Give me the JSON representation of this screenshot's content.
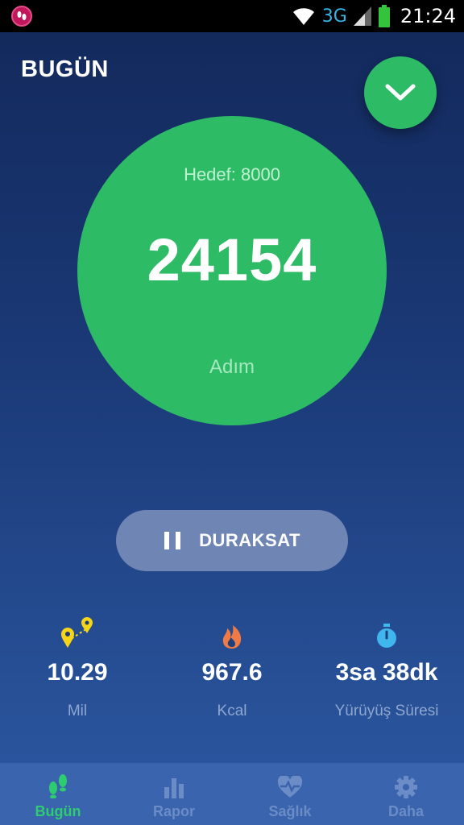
{
  "status_bar": {
    "network": "3G",
    "time": "21:24"
  },
  "header": {
    "title": "BUGÜN"
  },
  "steps": {
    "goal": "Hedef: 8000",
    "count": "24154",
    "unit": "Adım"
  },
  "pause_button": {
    "label": "DURAKSAT"
  },
  "stats": [
    {
      "icon": "map-pins-icon",
      "value": "10.29",
      "label": "Mil"
    },
    {
      "icon": "flame-icon",
      "value": "967.6",
      "label": "Kcal"
    },
    {
      "icon": "stopwatch-icon",
      "value": "3sa 38dk",
      "label": "Yürüyüş Süresi"
    }
  ],
  "tabs": [
    {
      "icon": "footprints-icon",
      "label": "Bugün",
      "active": true
    },
    {
      "icon": "bar-chart-icon",
      "label": "Rapor",
      "active": false
    },
    {
      "icon": "heart-pulse-icon",
      "label": "Sağlık",
      "active": false
    },
    {
      "icon": "gear-icon",
      "label": "Daha",
      "active": false
    }
  ],
  "colors": {
    "accent_green": "#2dbb66",
    "active_tab": "#2ecc71",
    "inactive_tab": "#6b8cc6",
    "map_pin": "#f5d515",
    "flame": "#f07a45",
    "stopwatch": "#3fb6ee"
  }
}
